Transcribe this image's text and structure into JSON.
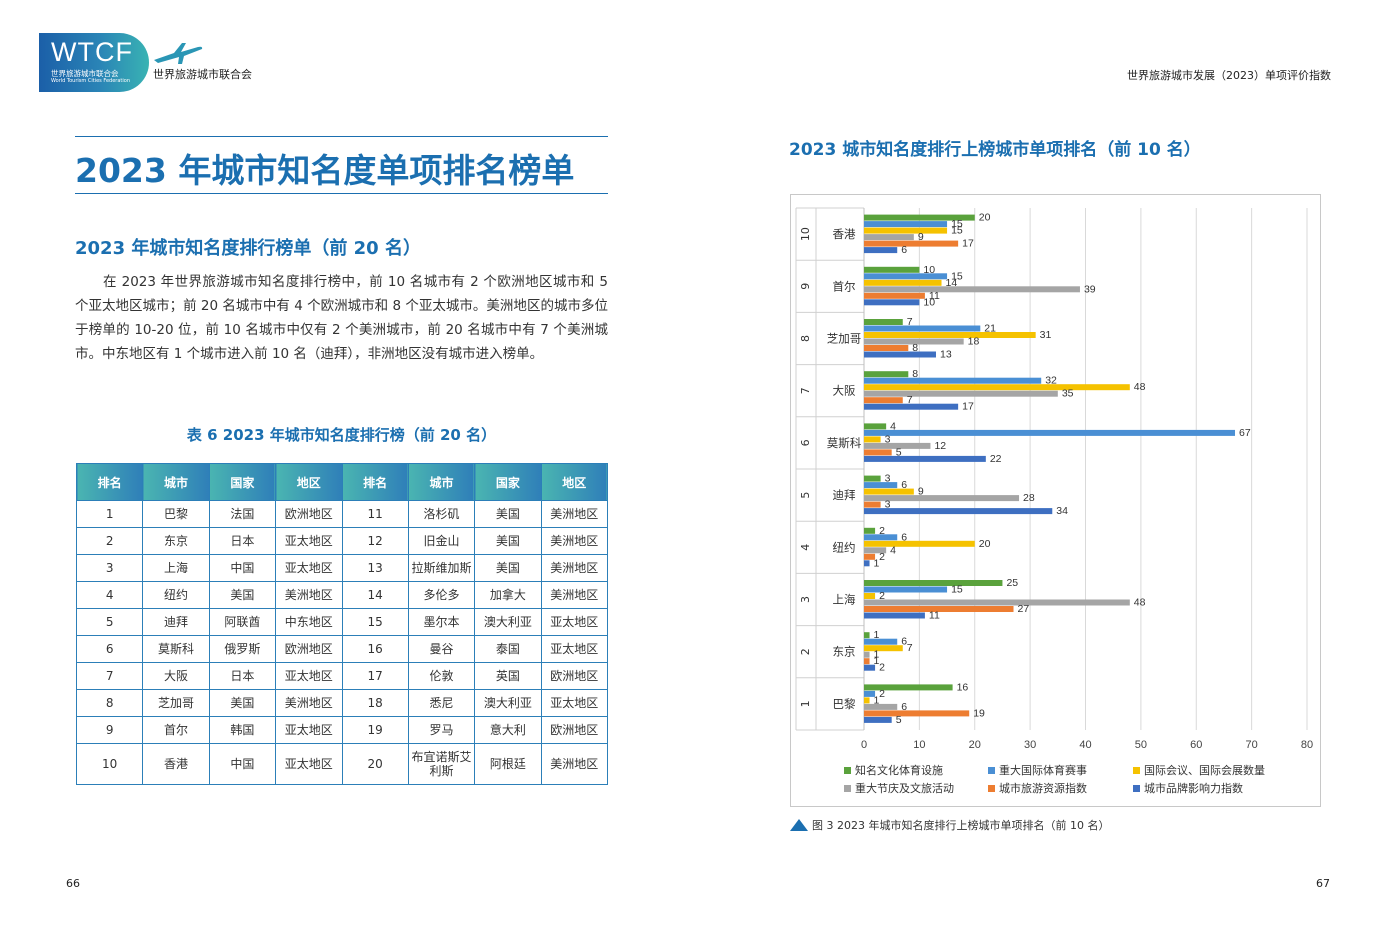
{
  "header": {
    "logo_text": "WTCF",
    "logo_cn": "世界旅游城市联合会",
    "logo_en": "World Tourism Cities Federation",
    "org_name": "世界旅游城市联合会",
    "report_title": "世界旅游城市发展（2023）单项评价指数"
  },
  "left_page": {
    "main_title": "2023 年城市知名度单项排名榜单",
    "section_title": "2023 年城市知名度排行榜单（前 20 名）",
    "paragraph": "在 2023 年世界旅游城市知名度排行榜中，前 10 名城市有 2 个欧洲地区城市和 5 个亚太地区城市；前 20 名城市中有 4 个欧洲城市和 8 个亚太城市。美洲地区的城市多位于榜单的 10-20 位，前 10 名城市中仅有 2 个美洲城市，前 20 名城市中有 7 个美洲城市。中东地区有 1 个城市进入前 10 名（迪拜），非洲地区没有城市进入榜单。",
    "table_caption": "表 6  2023 年城市知名度排行榜（前 20 名）",
    "table": {
      "headers": [
        "排名",
        "城市",
        "国家",
        "地区",
        "排名",
        "城市",
        "国家",
        "地区"
      ],
      "rows": [
        [
          "1",
          "巴黎",
          "法国",
          "欧洲地区",
          "11",
          "洛杉矶",
          "美国",
          "美洲地区"
        ],
        [
          "2",
          "东京",
          "日本",
          "亚太地区",
          "12",
          "旧金山",
          "美国",
          "美洲地区"
        ],
        [
          "3",
          "上海",
          "中国",
          "亚太地区",
          "13",
          "拉斯维加斯",
          "美国",
          "美洲地区"
        ],
        [
          "4",
          "纽约",
          "美国",
          "美洲地区",
          "14",
          "多伦多",
          "加拿大",
          "美洲地区"
        ],
        [
          "5",
          "迪拜",
          "阿联酋",
          "中东地区",
          "15",
          "墨尔本",
          "澳大利亚",
          "亚太地区"
        ],
        [
          "6",
          "莫斯科",
          "俄罗斯",
          "欧洲地区",
          "16",
          "曼谷",
          "泰国",
          "亚太地区"
        ],
        [
          "7",
          "大阪",
          "日本",
          "亚太地区",
          "17",
          "伦敦",
          "英国",
          "欧洲地区"
        ],
        [
          "8",
          "芝加哥",
          "美国",
          "美洲地区",
          "18",
          "悉尼",
          "澳大利亚",
          "亚太地区"
        ],
        [
          "9",
          "首尔",
          "韩国",
          "亚太地区",
          "19",
          "罗马",
          "意大利",
          "欧洲地区"
        ],
        [
          "10",
          "香港",
          "中国",
          "亚太地区",
          "20",
          "布宜诺斯艾利斯",
          "阿根廷",
          "美洲地区"
        ]
      ]
    },
    "page_number": "66"
  },
  "right_page": {
    "chart_title": "2023 城市知名度排行上榜城市单项排名（前 10 名）",
    "figure_caption": "图 3 2023 年城市知名度排行上榜城市单项排名（前 10 名）",
    "page_number": "67"
  },
  "chart_data": {
    "type": "bar",
    "orientation": "horizontal",
    "categories": [
      "香港",
      "首尔",
      "芝加哥",
      "大阪",
      "莫斯科",
      "迪拜",
      "纽约",
      "上海",
      "东京",
      "巴黎"
    ],
    "ranks": [
      "10",
      "9",
      "8",
      "7",
      "6",
      "5",
      "4",
      "3",
      "2",
      "1"
    ],
    "series": [
      {
        "name": "知名文化体育设施",
        "color": "#5aa23c",
        "values": [
          20,
          10,
          7,
          8,
          4,
          3,
          2,
          25,
          1,
          16
        ]
      },
      {
        "name": "重大国际体育赛事",
        "color": "#4a8fd4",
        "values": [
          15,
          15,
          21,
          32,
          67,
          6,
          6,
          15,
          6,
          2
        ]
      },
      {
        "name": "国际会议、国际会展数量",
        "color": "#f5c200",
        "values": [
          15,
          14,
          31,
          48,
          3,
          9,
          20,
          2,
          7,
          1
        ]
      },
      {
        "name": "重大节庆及文旅活动",
        "color": "#a5a5a5",
        "values": [
          9,
          39,
          18,
          35,
          12,
          28,
          4,
          48,
          1,
          6
        ]
      },
      {
        "name": "城市旅游资源指数",
        "color": "#ed7d31",
        "values": [
          17,
          11,
          8,
          7,
          5,
          3,
          2,
          27,
          1,
          19
        ]
      },
      {
        "name": "城市品牌影响力指数",
        "color": "#3e6fc1",
        "values": [
          6,
          10,
          13,
          17,
          22,
          34,
          1,
          11,
          2,
          5
        ]
      }
    ],
    "xlim": [
      0,
      80
    ],
    "xticks": [
      "0",
      "10",
      "20",
      "30",
      "40",
      "50",
      "60",
      "70",
      "80"
    ],
    "grid": "vertical",
    "legend": "bottom",
    "data_labels": true
  }
}
